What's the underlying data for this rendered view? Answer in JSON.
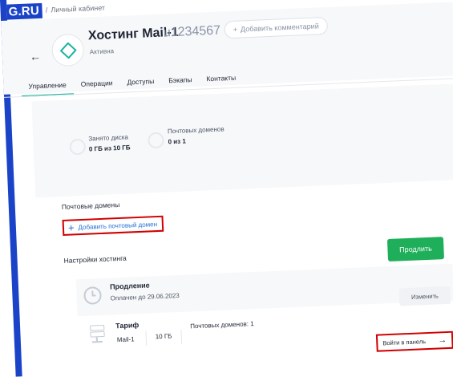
{
  "header": {
    "logo": "G.RU",
    "separator": "/",
    "breadcrumb": "Личный кабинет"
  },
  "service": {
    "back_icon": "←",
    "title": "Хостинг Mail-1",
    "id": "u1234567",
    "add_comment": "Добавить комментарий",
    "status": "Активна"
  },
  "tabs": [
    {
      "label": "Управление",
      "active": true
    },
    {
      "label": "Операции"
    },
    {
      "label": "Доступы"
    },
    {
      "label": "Бэкапы"
    },
    {
      "label": "Контакты"
    }
  ],
  "stats": [
    {
      "label": "Занято диска",
      "value": "0 ГБ из 10 ГБ"
    },
    {
      "label": "Почтовых доменов",
      "value": "0 из 1"
    }
  ],
  "mail_domains": {
    "title": "Почтовые домены",
    "add_label": "Добавить почтовый домен",
    "add_icon": "+"
  },
  "settings": {
    "title": "Настройки хостинга",
    "extend_button": "Продлить",
    "renewal": {
      "title": "Продление",
      "subtitle": "Оплачен до 29.06.2023",
      "icon": "clock-icon"
    },
    "change_button": "Изменить",
    "tariff": {
      "title": "Тариф",
      "name": "Mail-1",
      "size": "10 ГБ",
      "domains": "Почтовых доменов: 1",
      "icon": "server-icon"
    },
    "panel_link": "Войти в панель",
    "panel_arrow": "→"
  },
  "colors": {
    "accent": "#19b59e",
    "brand": "#1a43c8",
    "button_green": "#1fae5a",
    "link_blue": "#1f6fd6",
    "highlight_red": "#d00000"
  }
}
